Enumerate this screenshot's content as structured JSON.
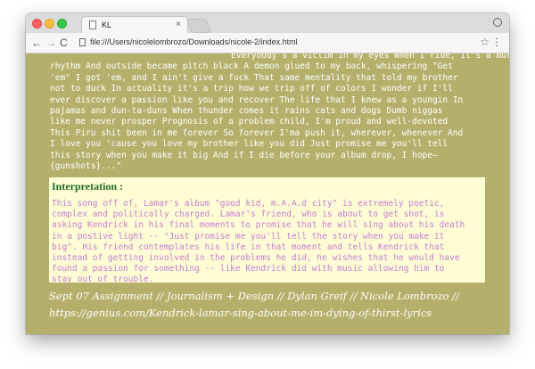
{
  "browser": {
    "tab_title": "KL",
    "tab_close": "×",
    "url": "file:///Users/nicolelombrozo/Downloads/nicole-2/index.html",
    "nav_back": "←",
    "nav_forward": "→",
    "nav_reload": "C",
    "star": "☆",
    "menu": "⋮"
  },
  "lyrics": {
    "lines": [
      "Everybody's a victim in my eyes When I ride, it's a murderous",
      "rhythm And outside became pitch black A demon glued to my back, whispering \"Get",
      "'em\" I got 'em, and I ain't give a fuck That same mentality that told my brother",
      "not to duck In actuality it's a trip how we trip off of colors I wonder if I'll",
      "ever discover a passion like you and recover The life that I knew as a youngin In",
      "pajamas and dun-ta-duns When thunder comes it rains cats and dogs Dumb niggas",
      "like me never prosper Prognosis of a problem child, I'm proud and well-devoted",
      "This Piru shit been in me forever So forever I'ma push it, wherever, whenever And",
      "I love you 'cause you love my brother like you did Just promise me you'll tell",
      "this story when you make it big And if I die before your album drop, I hope—",
      "{gunshots}...\""
    ]
  },
  "interpretation": {
    "heading": "Interpretation :",
    "lines": [
      "This song off of, Lamar's album \"good kid, m.A.A.d city\" is extremely poetic,",
      "complex and politically charged. Lamar's friend, who is about to get shot, is",
      "asking Kendrick in his final moments to promise that he will sing about his death",
      "in a postive light -- \"Just promise me you'll tell the story when you make it",
      "big\". His friend contemplates his life in that moment and tells Kendrick that",
      "instead of getting involved in the problems he did, he wishes that he would have",
      "found a passion for something -- like Kendrick did with music allowing him to",
      "stay out of trouble."
    ]
  },
  "footer": {
    "line1": "Sept 07 Assignment // Journalism + Design // Dylan Greif // Nicole Lombrozo //",
    "line2": "https://genius.com/Kendrick-lamar-sing-about-me-im-dying-of-thirst-lyrics"
  },
  "colors": {
    "page_background": "#b4b06c",
    "interpretation_background": "#fffdd4",
    "heading_color": "#1e6b1e",
    "interpretation_text": "#c27cd6"
  }
}
